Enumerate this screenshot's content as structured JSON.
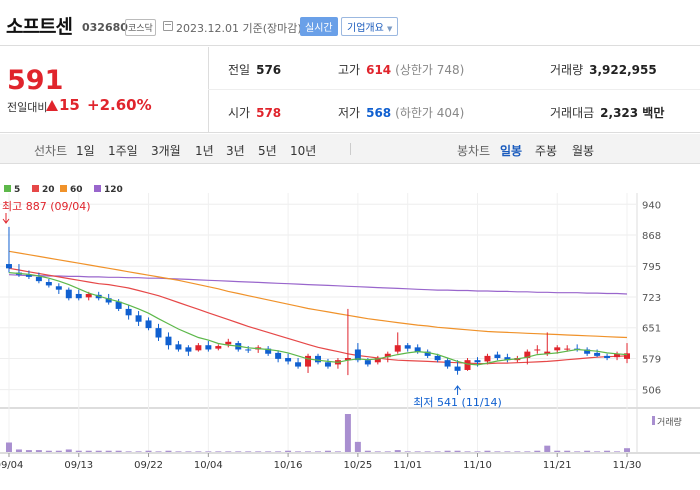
{
  "header": {
    "name": "소프트센",
    "code": "032680",
    "market": "코스닥",
    "date": "2023.12.01  기준(장마감)",
    "realtime_btn": "실시간",
    "company_btn": "기업개요"
  },
  "summary": {
    "price": "591",
    "change_label": "전일대비",
    "change": "15",
    "change_pct": "+2.60%",
    "prev_label": "전일",
    "prev": "576",
    "high_label": "고가",
    "high": "614",
    "upper_limit": "(상한가 748)",
    "volume_label": "거래량",
    "volume": "3,922,955",
    "open_label": "시가",
    "open": "578",
    "low_label": "저가",
    "low": "568",
    "lower_limit": "(하한가 404)",
    "amount_label": "거래대금",
    "amount": "2,323 백만"
  },
  "toolbar": {
    "line_label": "선차트",
    "line_items": [
      "1일",
      "1주일",
      "3개월",
      "1년",
      "3년",
      "5년",
      "10년"
    ],
    "candle_label": "봉차트",
    "candle_items": [
      "일봉",
      "주봉",
      "월봉"
    ],
    "candle_active": "일봉"
  },
  "colors": {
    "up": "#e0242c",
    "down": "#1060d0",
    "ma5": "#5db84a",
    "ma20": "#e64848",
    "ma60": "#f0922a",
    "ma120": "#9966cc",
    "volume": "#a98fd0"
  },
  "chart_data": {
    "type": "candlestick",
    "legend": [
      "5",
      "20",
      "60",
      "120"
    ],
    "y_ticks": [
      940,
      868,
      795,
      723,
      651,
      579,
      506
    ],
    "ylim": [
      470,
      950
    ],
    "x_labels": [
      "09/04",
      "09/13",
      "09/22",
      "10/04",
      "10/16",
      "10/25",
      "11/01",
      "11/10",
      "11/21",
      "11/30"
    ],
    "x_label_days": [
      0,
      7,
      14,
      20,
      28,
      35,
      40,
      47,
      55,
      62
    ],
    "annotations": {
      "max": "최고 887 (09/04)",
      "min": "최저 541 (11/14)"
    },
    "volume_label": "거래량",
    "ohlc": [
      [
        800,
        887,
        780,
        790
      ],
      [
        780,
        800,
        770,
        775
      ],
      [
        775,
        785,
        765,
        770
      ],
      [
        770,
        780,
        755,
        760
      ],
      [
        758,
        765,
        745,
        750
      ],
      [
        748,
        755,
        730,
        740
      ],
      [
        740,
        745,
        715,
        720
      ],
      [
        730,
        740,
        715,
        720
      ],
      [
        722,
        735,
        715,
        730
      ],
      [
        728,
        735,
        715,
        720
      ],
      [
        720,
        730,
        705,
        710
      ],
      [
        712,
        718,
        690,
        695
      ],
      [
        695,
        705,
        670,
        680
      ],
      [
        680,
        690,
        655,
        665
      ],
      [
        668,
        675,
        645,
        650
      ],
      [
        650,
        660,
        620,
        628
      ],
      [
        630,
        640,
        600,
        610
      ],
      [
        612,
        620,
        595,
        600
      ],
      [
        605,
        610,
        585,
        595
      ],
      [
        598,
        615,
        595,
        610
      ],
      [
        610,
        620,
        595,
        600
      ],
      [
        602,
        612,
        598,
        608
      ],
      [
        612,
        625,
        605,
        618
      ],
      [
        615,
        620,
        595,
        600
      ],
      [
        600,
        608,
        592,
        598
      ],
      [
        600,
        610,
        592,
        605
      ],
      [
        602,
        608,
        585,
        590
      ],
      [
        592,
        598,
        570,
        578
      ],
      [
        580,
        590,
        565,
        572
      ],
      [
        570,
        580,
        555,
        560
      ],
      [
        560,
        590,
        545,
        585
      ],
      [
        585,
        590,
        565,
        570
      ],
      [
        570,
        578,
        555,
        560
      ],
      [
        565,
        580,
        555,
        575
      ],
      [
        575,
        695,
        540,
        580
      ],
      [
        600,
        615,
        570,
        575
      ],
      [
        575,
        580,
        560,
        565
      ],
      [
        570,
        585,
        565,
        580
      ],
      [
        582,
        595,
        570,
        590
      ],
      [
        595,
        640,
        590,
        610
      ],
      [
        610,
        615,
        595,
        602
      ],
      [
        605,
        612,
        590,
        595
      ],
      [
        595,
        600,
        580,
        585
      ],
      [
        585,
        590,
        570,
        575
      ],
      [
        575,
        580,
        555,
        560
      ],
      [
        560,
        575,
        541,
        550
      ],
      [
        552,
        580,
        550,
        575
      ],
      [
        575,
        582,
        560,
        570
      ],
      [
        572,
        590,
        565,
        585
      ],
      [
        588,
        595,
        575,
        580
      ],
      [
        582,
        590,
        570,
        575
      ],
      [
        575,
        585,
        570,
        580
      ],
      [
        580,
        600,
        565,
        595
      ],
      [
        598,
        610,
        590,
        600
      ],
      [
        590,
        640,
        585,
        595
      ],
      [
        598,
        610,
        590,
        605
      ],
      [
        600,
        610,
        595,
        602
      ],
      [
        602,
        612,
        595,
        600
      ],
      [
        600,
        605,
        585,
        590
      ],
      [
        592,
        600,
        582,
        585
      ],
      [
        585,
        590,
        575,
        580
      ],
      [
        582,
        595,
        575,
        590
      ],
      [
        578,
        615,
        568,
        591
      ]
    ],
    "ma5": [
      780,
      778,
      776,
      772,
      767,
      760,
      752,
      742,
      732,
      725,
      718,
      712,
      704,
      695,
      685,
      672,
      660,
      648,
      638,
      628,
      622,
      614,
      610,
      608,
      604,
      602,
      600,
      597,
      592,
      585,
      578,
      575,
      572,
      570,
      575,
      578,
      576,
      578,
      583,
      588,
      592,
      595,
      593,
      588,
      580,
      572,
      566,
      564,
      568,
      573,
      576,
      578,
      582,
      588,
      590,
      592,
      596,
      600,
      598,
      596,
      592,
      590,
      588
    ],
    "ma20": [
      790,
      786,
      782,
      778,
      774,
      770,
      766,
      762,
      758,
      754,
      752,
      748,
      744,
      738,
      732,
      726,
      718,
      710,
      702,
      694,
      686,
      678,
      670,
      662,
      654,
      647,
      640,
      633,
      626,
      619,
      612,
      605,
      600,
      595,
      590,
      586,
      583,
      580,
      577,
      575,
      574,
      573,
      572,
      571,
      570,
      569,
      568,
      567,
      567,
      568,
      568,
      569,
      570,
      571,
      572,
      574,
      576,
      578,
      580,
      582,
      583,
      584,
      585
    ],
    "ma60": [
      830,
      826,
      822,
      818,
      814,
      810,
      806,
      802,
      798,
      794,
      790,
      786,
      782,
      778,
      774,
      770,
      766,
      762,
      757,
      752,
      747,
      742,
      736,
      731,
      726,
      721,
      716,
      711,
      706,
      701,
      696,
      692,
      688,
      684,
      680,
      676,
      672,
      669,
      666,
      663,
      660,
      657,
      655,
      652,
      650,
      648,
      646,
      644,
      642,
      641,
      640,
      639,
      638,
      637,
      636,
      635,
      634,
      633,
      632,
      631,
      630,
      629,
      628
    ],
    "ma120": [
      775,
      774,
      773,
      773,
      772,
      772,
      771,
      771,
      770,
      770,
      769,
      769,
      768,
      768,
      767,
      767,
      766,
      765,
      764,
      763,
      762,
      761,
      760,
      759,
      758,
      757,
      756,
      755,
      754,
      753,
      752,
      751,
      750,
      749,
      748,
      747,
      746,
      745,
      744,
      743,
      742,
      741,
      740,
      739,
      739,
      738,
      738,
      737,
      737,
      736,
      736,
      735,
      735,
      734,
      734,
      733,
      733,
      733,
      732,
      732,
      731,
      731,
      730
    ],
    "volume": [
      15,
      4,
      3,
      3,
      2,
      2,
      4,
      2,
      2,
      2,
      2,
      2,
      1,
      1,
      2,
      1,
      2,
      1,
      1,
      1,
      1,
      1,
      1,
      1,
      1,
      1,
      1,
      1,
      2,
      1,
      1,
      1,
      2,
      1,
      60,
      16,
      2,
      1,
      1,
      3,
      1,
      1,
      1,
      1,
      2,
      2,
      1,
      1,
      2,
      1,
      1,
      1,
      1,
      2,
      10,
      2,
      2,
      1,
      2,
      1,
      2,
      1,
      6
    ]
  }
}
